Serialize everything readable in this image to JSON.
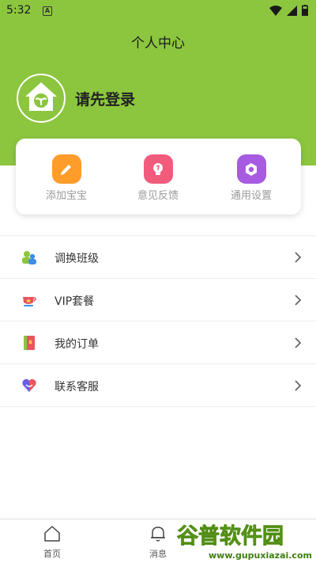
{
  "status": {
    "time": "5:32",
    "notification_glyph": "A"
  },
  "header": {
    "title": "个人中心"
  },
  "profile": {
    "login_text": "请先登录"
  },
  "quick_actions": [
    {
      "label": "添加宝宝",
      "icon": "pencil-icon",
      "color": "#ff9c2a"
    },
    {
      "label": "意见反馈",
      "icon": "lightbulb-icon",
      "color": "#f25b7c"
    },
    {
      "label": "通用设置",
      "icon": "settings-icon",
      "color": "#a65be0"
    }
  ],
  "menu": [
    {
      "label": "调换班级",
      "icon": "people-icon"
    },
    {
      "label": "VIP套餐",
      "icon": "vip-cup-icon"
    },
    {
      "label": "我的订单",
      "icon": "order-book-icon"
    },
    {
      "label": "联系客服",
      "icon": "heart-service-icon"
    }
  ],
  "bottom_nav": [
    {
      "label": "首页",
      "icon": "home-icon"
    },
    {
      "label": "消息",
      "icon": "bell-icon"
    }
  ],
  "watermark": {
    "brand": "谷普软件园",
    "url": "www.gupuxiazai.com"
  },
  "colors": {
    "header_green": "#8cc63f",
    "card_bg": "#ffffff",
    "text_gray": "#9a9a9a"
  }
}
